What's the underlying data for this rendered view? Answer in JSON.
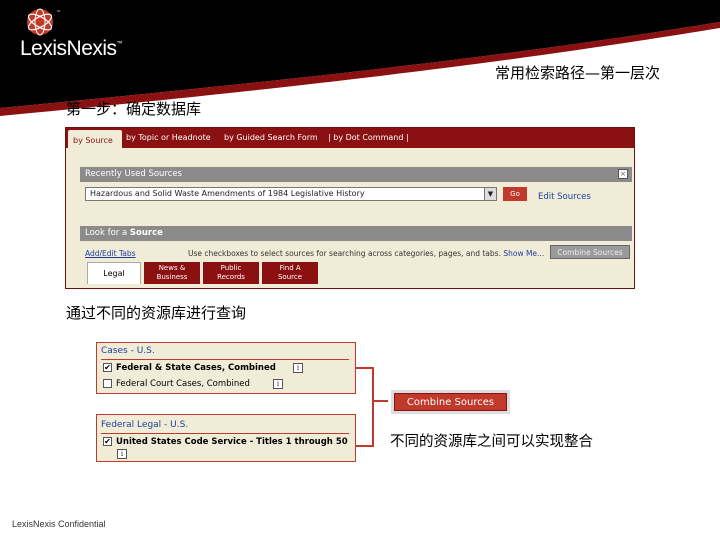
{
  "header": {
    "brand": "LexisNexis",
    "brand_tm": "™",
    "logo_tm": "™",
    "slide_title": "常用检索路径—第一层次"
  },
  "step_title": "第一步：确定数据库",
  "main_tabs": {
    "active": "by Source",
    "items": [
      "by Topic or Headnote",
      "by Guided Search Form",
      "| by Dot Command |"
    ]
  },
  "recent_sources": {
    "heading": "Recently Used Sources",
    "close": "×",
    "selected_source": "Hazardous and Solid Waste Amendments of 1984 Legislative History",
    "go_label": "Go",
    "edit_link": "Edit Sources"
  },
  "look_for_source": {
    "heading_prefix": "Look for a ",
    "heading_bold": "Source",
    "add_edit": "Add/Edit Tabs",
    "hint": "Use checkboxes to select sources for searching across categories, pages, and tabs.",
    "show_me": "Show Me...",
    "combine_button": "Combine Sources",
    "subtabs": [
      {
        "label": "Legal"
      },
      {
        "line1": "News &",
        "line2": "Business"
      },
      {
        "line1": "Public",
        "line2": "Records"
      },
      {
        "line1": "Find A",
        "line2": "Source"
      }
    ]
  },
  "sub_title": "通过不同的资源库进行查询",
  "cases_box": {
    "title_a": "Cases",
    "title_sep": " - ",
    "title_b": "U.S.",
    "rows": [
      {
        "label": "Federal & State Cases, Combined",
        "checked": true,
        "check_mark": "✔"
      },
      {
        "label": "Federal Court Cases, Combined",
        "checked": false,
        "check_mark": ""
      }
    ],
    "info": "i"
  },
  "federal_box": {
    "title_a": "Federal Legal",
    "title_sep": " - ",
    "title_b": "U.S.",
    "rows": [
      {
        "label": "United States Code Service - Titles 1 through 50",
        "checked": true,
        "check_mark": "✔"
      }
    ],
    "info": "i"
  },
  "combine_big": "Combine Sources",
  "caption": "不同的资源库之间可以实现整合",
  "footer": "LexisNexis Confidential",
  "colors": {
    "brand_red": "#8b1012",
    "accent_red": "#c0392b",
    "panel_bg": "#f1ecd8",
    "link_blue": "#1b3fa0"
  }
}
